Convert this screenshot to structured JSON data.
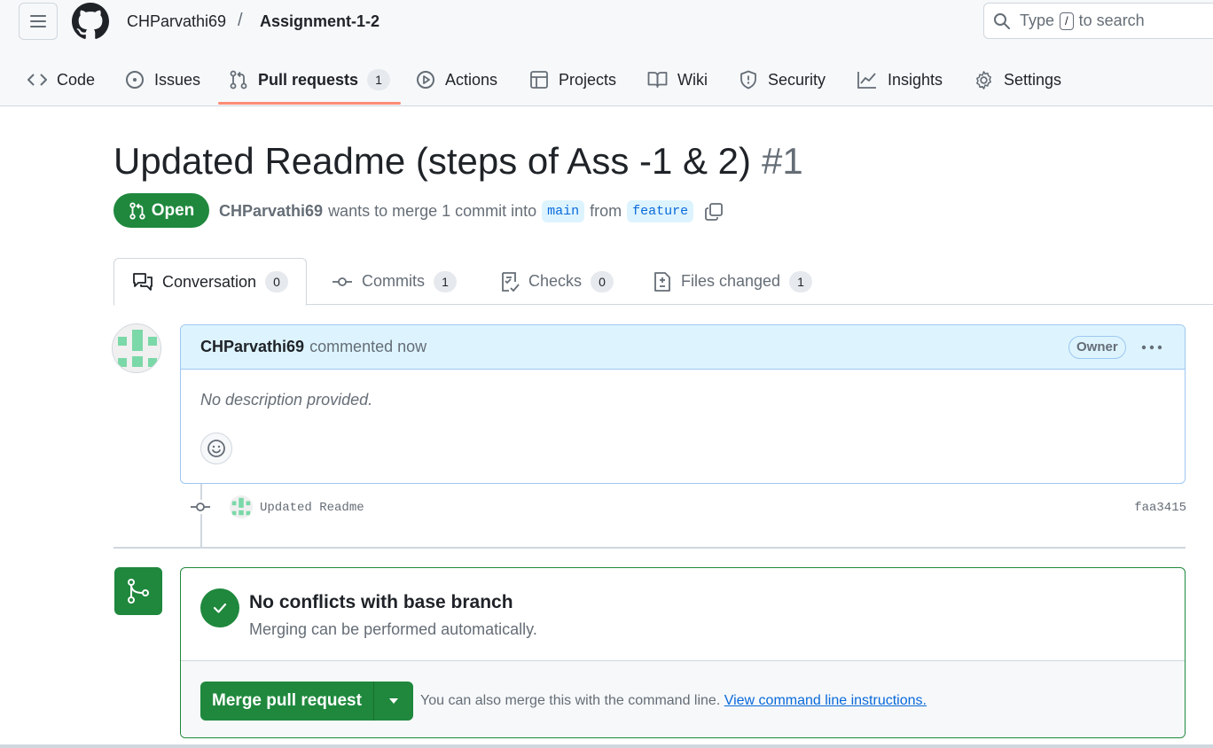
{
  "header": {
    "owner": "CHParvathi69",
    "separator": "/",
    "repo": "Assignment-1-2",
    "search": {
      "prefix": "Type",
      "key": "/",
      "suffix": "to search"
    }
  },
  "repo_tabs": [
    {
      "label": "Code",
      "icon": "code-icon"
    },
    {
      "label": "Issues",
      "icon": "issue-icon"
    },
    {
      "label": "Pull requests",
      "icon": "pull-request-icon",
      "count": "1",
      "active": true
    },
    {
      "label": "Actions",
      "icon": "play-icon"
    },
    {
      "label": "Projects",
      "icon": "table-icon"
    },
    {
      "label": "Wiki",
      "icon": "book-icon"
    },
    {
      "label": "Security",
      "icon": "shield-icon"
    },
    {
      "label": "Insights",
      "icon": "graph-icon"
    },
    {
      "label": "Settings",
      "icon": "gear-icon"
    }
  ],
  "pr": {
    "title": "Updated Readme (steps of Ass -1 & 2)",
    "number": "#1",
    "state": "Open",
    "author": "CHParvathi69",
    "merge_text": "wants to merge 1 commit into",
    "base_branch": "main",
    "from_text": "from",
    "head_branch": "feature"
  },
  "pr_tabs": [
    {
      "label": "Conversation",
      "count": "0",
      "icon": "comment-discussion-icon",
      "active": true
    },
    {
      "label": "Commits",
      "count": "1",
      "icon": "commit-icon"
    },
    {
      "label": "Checks",
      "count": "0",
      "icon": "checklist-icon"
    },
    {
      "label": "Files changed",
      "count": "1",
      "icon": "diff-icon"
    }
  ],
  "comment": {
    "author": "CHParvathi69",
    "action": "commented now",
    "badge": "Owner",
    "body": "No description provided."
  },
  "commit": {
    "message": "Updated Readme",
    "sha": "faa3415"
  },
  "merge_box": {
    "title": "No conflicts with base branch",
    "subtitle": "Merging can be performed automatically.",
    "button": "Merge pull request",
    "note": "You can also merge this with the command line.",
    "link": "View command line instructions."
  },
  "colors": {
    "accent_green": "#1f883d",
    "link_blue": "#0969da",
    "tab_underline": "#fd8c73",
    "comment_header": "#ddf4ff"
  }
}
